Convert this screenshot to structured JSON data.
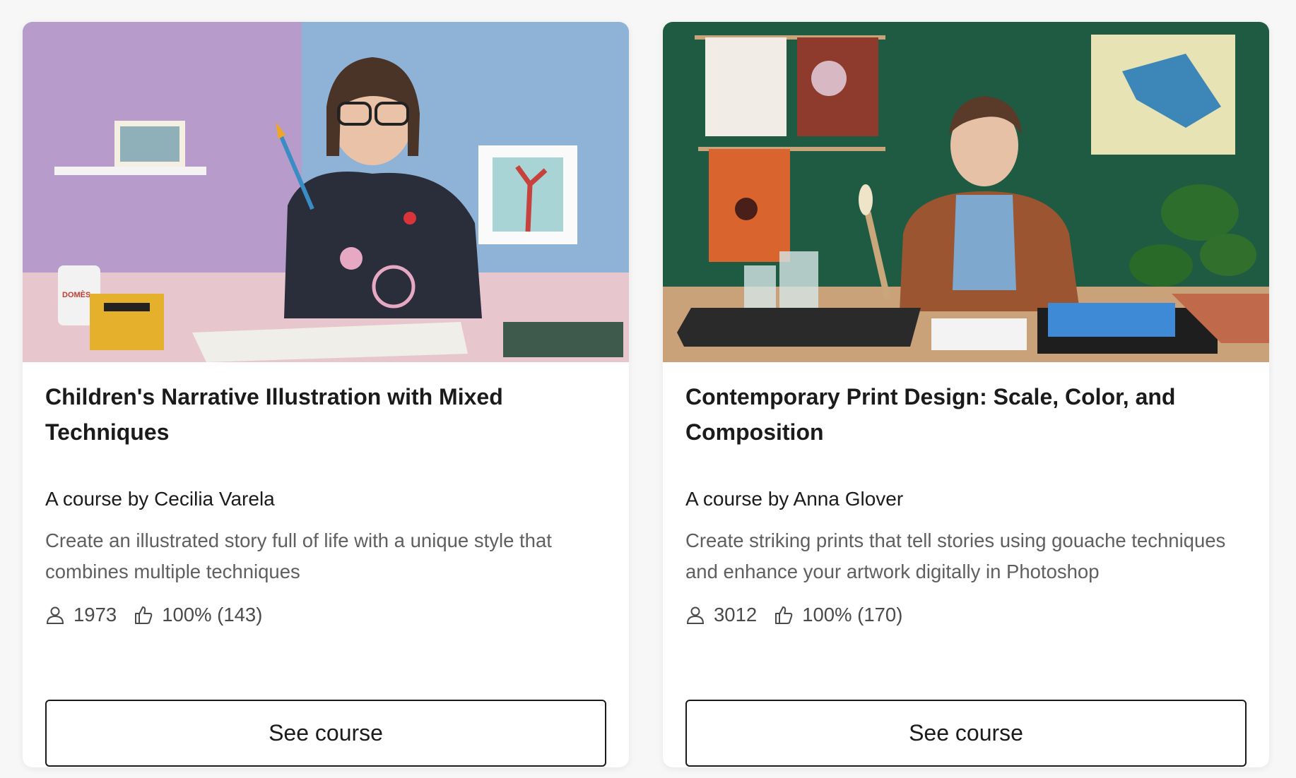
{
  "courses": [
    {
      "title": "Children's Narrative Illustration with Mixed Techniques",
      "author": "A course by Cecilia Varela",
      "description": "Create an illustrated story full of life with a unique style that combines multiple techniques",
      "students": "1973",
      "rating": "100% (143)",
      "button_label": "See course",
      "image_text": "DOMÈS"
    },
    {
      "title": "Contemporary Print Design: Scale, Color, and Composition",
      "author": "A course by Anna Glover",
      "description": "Create striking prints that tell stories using gouache techniques and enhance your artwork digitally in Photoshop",
      "students": "3012",
      "rating": "100% (170)",
      "button_label": "See course"
    }
  ],
  "icons": {
    "students": "user-icon",
    "rating": "thumbs-up-icon"
  }
}
